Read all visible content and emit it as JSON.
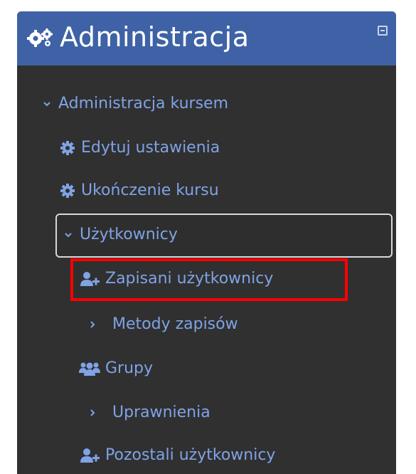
{
  "block": {
    "title": "Administracja",
    "header_icon": "gears-icon",
    "collapse_icon": "collapse-icon"
  },
  "tree": {
    "course_admin": "Administracja kursem",
    "edit_settings": "Edytuj ustawienia",
    "course_completion": "Ukończenie kursu",
    "users": "Użytkownicy",
    "enrolled_users": "Zapisani użytkownicy",
    "enrolment_methods": "Metody zapisów",
    "groups": "Grupy",
    "permissions": "Uprawnienia",
    "other_users": "Pozostali użytkownicy"
  },
  "colors": {
    "header_bg": "#3e62a5",
    "panel_bg": "#303030",
    "link": "#7fa3e6",
    "highlight": "#ff0000"
  }
}
